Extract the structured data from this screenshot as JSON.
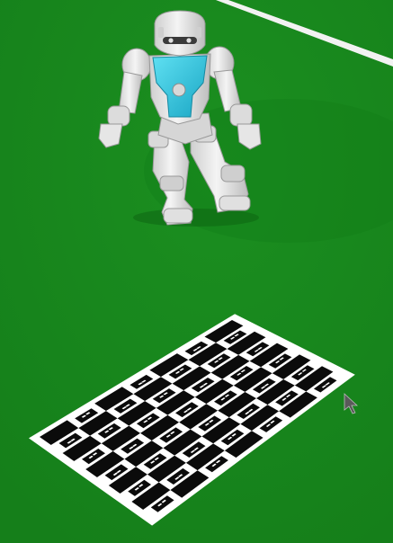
{
  "scene": {
    "field_color": "#178a1c",
    "field_shadow_color": "#127a17",
    "line_color": "#f2f2f2",
    "board_dark": "#0b0b0b",
    "board_light": "#ffffff",
    "robot_body_color": "#e9e9e9",
    "robot_accent_color": "#2ec4e0",
    "cursor_color": "#555555",
    "board_rows": 7,
    "board_cols": 10
  }
}
